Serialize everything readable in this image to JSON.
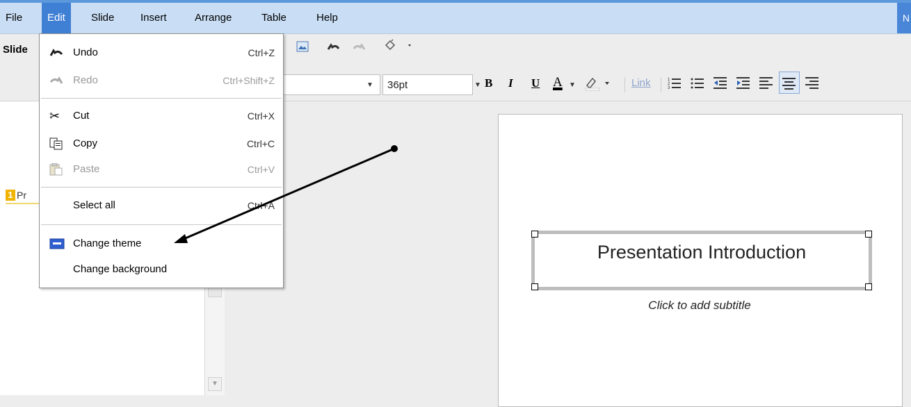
{
  "menubar": {
    "items": [
      "File",
      "Edit",
      "Slide",
      "Insert",
      "Arrange",
      "Table",
      "Help"
    ],
    "active": "Edit",
    "right_edge_text": "N"
  },
  "toolbar": {
    "slide_label": "Slide",
    "font_size": "36pt",
    "bold": "B",
    "italic": "I",
    "underline": "U",
    "text_color": "A",
    "link": "Link"
  },
  "slides_panel": {
    "slide_number": "1",
    "slide_title_fragment": "Pr"
  },
  "edit_menu": {
    "items": [
      {
        "label": "Undo",
        "shortcut": "Ctrl+Z",
        "icon": "undo-icon",
        "disabled": false
      },
      {
        "label": "Redo",
        "shortcut": "Ctrl+Shift+Z",
        "icon": "redo-icon",
        "disabled": true
      },
      {
        "label": "Cut",
        "shortcut": "Ctrl+X",
        "icon": "scissors-icon",
        "disabled": false
      },
      {
        "label": "Copy",
        "shortcut": "Ctrl+C",
        "icon": "copy-icon",
        "disabled": false
      },
      {
        "label": "Paste",
        "shortcut": "Ctrl+V",
        "icon": "paste-icon",
        "disabled": true
      },
      {
        "label": "Select all",
        "shortcut": "Ctrl+A",
        "icon": "",
        "disabled": false
      },
      {
        "label": "Change theme",
        "shortcut": "",
        "icon": "theme-icon",
        "disabled": false
      },
      {
        "label": "Change background",
        "shortcut": "",
        "icon": "",
        "disabled": false
      }
    ]
  },
  "slide": {
    "title": "Presentation Introduction",
    "subtitle_placeholder": "Click to add subtitle"
  },
  "colors": {
    "menubar_bg": "#c9def5",
    "menu_active": "#3f7fd4",
    "slide_badge": "#f0b400"
  }
}
